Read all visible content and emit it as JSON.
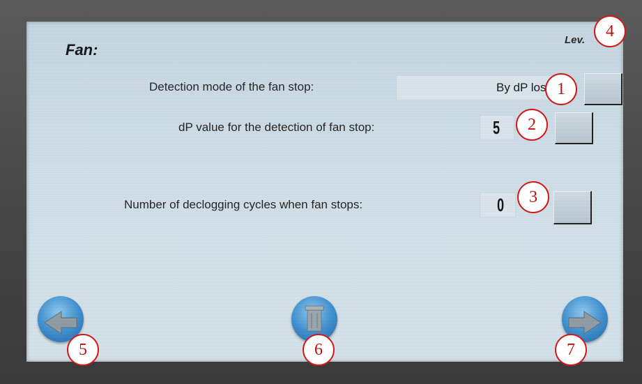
{
  "title": "Fan:",
  "level_label": "Lev.",
  "settings": [
    {
      "label": "Detection mode of the fan stop:",
      "value": "By dP loss"
    },
    {
      "label": "dP value for the detection of fan stop:",
      "value": "5"
    },
    {
      "label": "Number of declogging cycles when fan stops:",
      "value": "0"
    }
  ],
  "markers": [
    "1",
    "2",
    "3",
    "4",
    "5",
    "6",
    "7"
  ],
  "nav": {
    "back_icon": "arrow-left-icon",
    "home_icon": "trash-icon",
    "next_icon": "arrow-right-icon"
  },
  "colors": {
    "nav_blue": "#3d8fd0",
    "marker_red": "#d11818",
    "screen_bg": "#cfdfe8"
  }
}
